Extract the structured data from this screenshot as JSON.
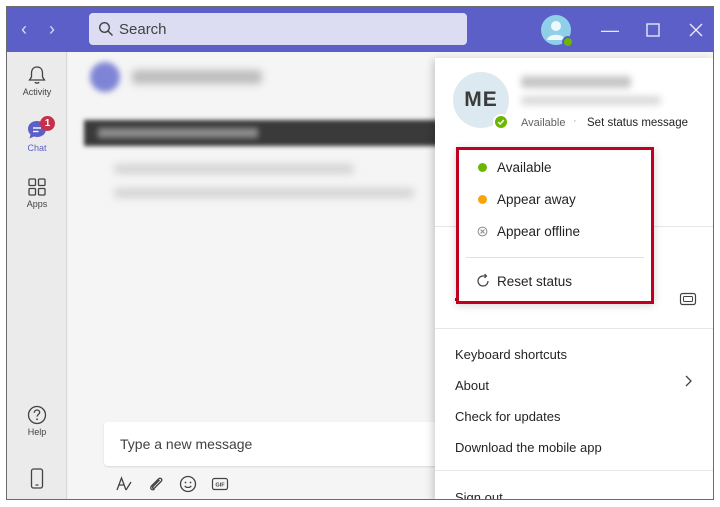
{
  "search": {
    "placeholder": "Search"
  },
  "rail": {
    "activity_label": "Activity",
    "chat_label": "Chat",
    "chat_badge": "1",
    "apps_label": "Apps",
    "help_label": "Help"
  },
  "composer": {
    "placeholder": "Type a new message"
  },
  "profile": {
    "initials": "ME",
    "status": "Available",
    "separator": "·",
    "set_status_label": "Set status message"
  },
  "status_menu": {
    "items": [
      {
        "label": "Available",
        "color": "#6bb700"
      },
      {
        "label": "Appear away",
        "color": "#f8a50b"
      },
      {
        "label": "Appear offline",
        "color": "#8a8a8a"
      }
    ],
    "reset_label": "Reset status"
  },
  "menu": {
    "keyboard_shortcuts": "Keyboard shortcuts",
    "about": "About",
    "check_updates": "Check for updates",
    "download_mobile": "Download the mobile app",
    "sign_out": "Sign out"
  },
  "colors": {
    "brand": "#5b5fc7",
    "highlight": "#c00020",
    "available": "#6bb700",
    "away": "#f8a50b",
    "badge": "#c4314b"
  }
}
